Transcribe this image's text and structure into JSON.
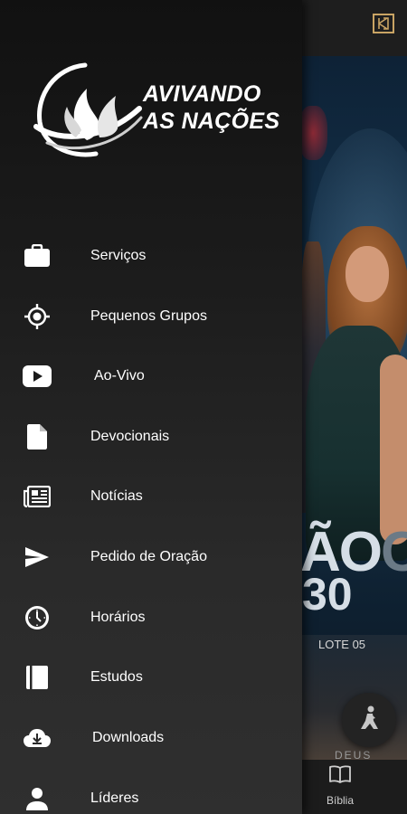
{
  "drawer": {
    "logo": {
      "line1": "AVIVANDO",
      "line2": "AS NAÇÕES"
    },
    "items": [
      {
        "label": "Serviços",
        "icon": "briefcase-icon"
      },
      {
        "label": "Pequenos Grupos",
        "icon": "location-target-icon"
      },
      {
        "label": "Ao-Vivo",
        "icon": "play-video-icon"
      },
      {
        "label": "Devocionais",
        "icon": "document-icon"
      },
      {
        "label": "Notícias",
        "icon": "newspaper-icon"
      },
      {
        "label": "Pedido de Oração",
        "icon": "send-icon"
      },
      {
        "label": "Horários",
        "icon": "clock-icon"
      },
      {
        "label": "Estudos",
        "icon": "book-icon"
      },
      {
        "label": "Downloads",
        "icon": "cloud-download-icon"
      },
      {
        "label": "Líderes",
        "icon": "person-icon"
      }
    ]
  },
  "background": {
    "banner": {
      "line1_bright": "ÃO",
      "line1_dim": "C",
      "line2": "30",
      "lote": "LOTE 05",
      "footer": "DEUS"
    },
    "bottom_nav": {
      "bible_label": "Bíblia"
    }
  },
  "colors": {
    "drawer_top": "#111111",
    "drawer_bottom": "#2f2f2f",
    "text": "#ffffff",
    "badge": "#c9a464"
  }
}
